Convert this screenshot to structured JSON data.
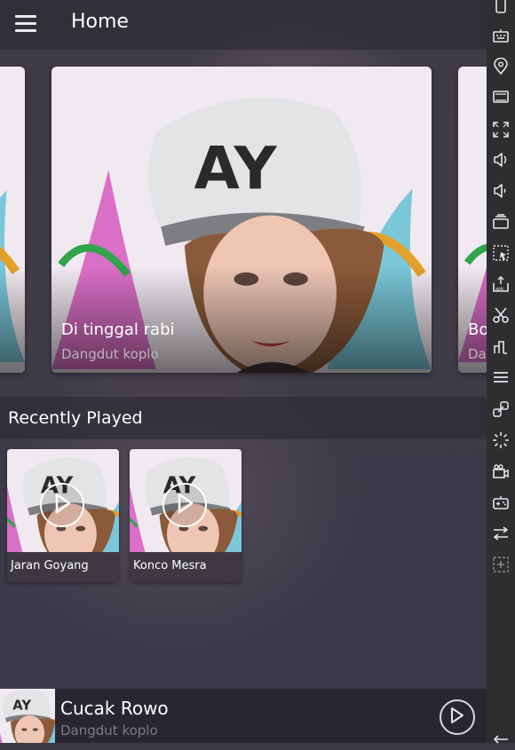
{
  "header": {
    "title": "Home",
    "menu_icon": "hamburger-icon"
  },
  "carousel": {
    "cards": [
      {
        "title": "Di tinggal rabi",
        "subtitle": "Dangdut koplo"
      },
      {
        "title": "Bo",
        "subtitle": "Da"
      }
    ]
  },
  "recently_played": {
    "heading": "Recently Played",
    "items": [
      {
        "title": "Jaran Goyang"
      },
      {
        "title": "Konco Mesra"
      }
    ]
  },
  "player": {
    "title": "Cucak Rowo",
    "subtitle": "Dangdut koplo",
    "play_icon": "play-circle-icon"
  },
  "side_toolbar": {
    "icons": [
      "phone-icon",
      "keyboard-icon",
      "location-pin-icon",
      "screen-icon",
      "fullscreen-icon",
      "volume-up-icon",
      "volume-down-icon",
      "camera-icon",
      "screenshot-icon",
      "apk-install-icon",
      "cut-icon",
      "stats-icon",
      "menu-lines-icon",
      "link-icon",
      "loading-icon",
      "video-icon",
      "gamepad-icon",
      "transfer-icon",
      "add-icon",
      "back-icon"
    ]
  },
  "colors": {
    "accent": "#c11ec8",
    "background": "#3c3a45",
    "sidebar": "#2e2e31"
  }
}
